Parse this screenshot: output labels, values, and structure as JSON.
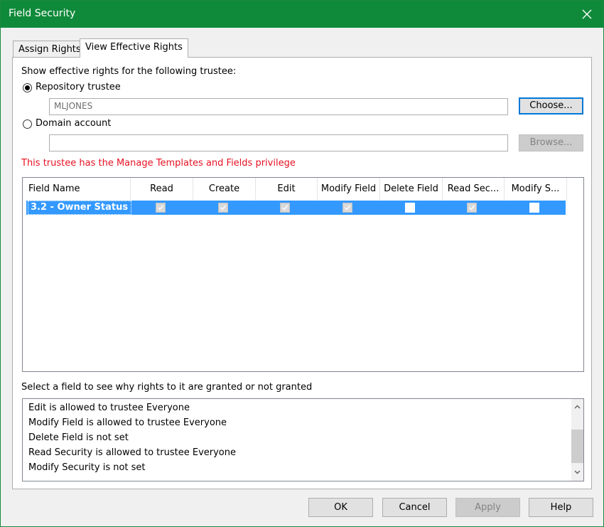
{
  "window": {
    "title": "Field Security"
  },
  "tabs": [
    {
      "label": "Assign Rights",
      "active": false
    },
    {
      "label": "View Effective Rights",
      "active": true
    }
  ],
  "trustee": {
    "prompt": "Show effective rights for the following trustee:",
    "repository_label": "Repository trustee",
    "repository_selected": true,
    "repository_value": "MLJONES",
    "choose_label": "Choose...",
    "domain_label": "Domain account",
    "domain_selected": false,
    "domain_value": "",
    "browse_label": "Browse..."
  },
  "privilege_notice": "This trustee has the Manage Templates and Fields privilege",
  "grid": {
    "columns": [
      "Field Name",
      "Read",
      "Create",
      "Edit",
      "Modify Field",
      "Delete Field",
      "Read Sec...",
      "Modify S..."
    ],
    "rows": [
      {
        "name": "3.2 - Owner Status",
        "rights": [
          true,
          true,
          true,
          true,
          false,
          true,
          false
        ],
        "selected": true
      }
    ]
  },
  "reasons": {
    "label": "Select a field to see why rights to it are granted or not granted",
    "items": [
      "Edit is allowed to trustee Everyone",
      "Modify Field is allowed to trustee Everyone",
      "Delete Field is not set",
      "Read Security is allowed to trustee Everyone",
      "Modify Security is not set"
    ]
  },
  "buttons": {
    "ok": "OK",
    "cancel": "Cancel",
    "apply": "Apply",
    "help": "Help"
  },
  "colors": {
    "titlebar": "#0f8a3a",
    "selection": "#3399ff",
    "warning": "#e81123",
    "focus": "#0078d7"
  }
}
